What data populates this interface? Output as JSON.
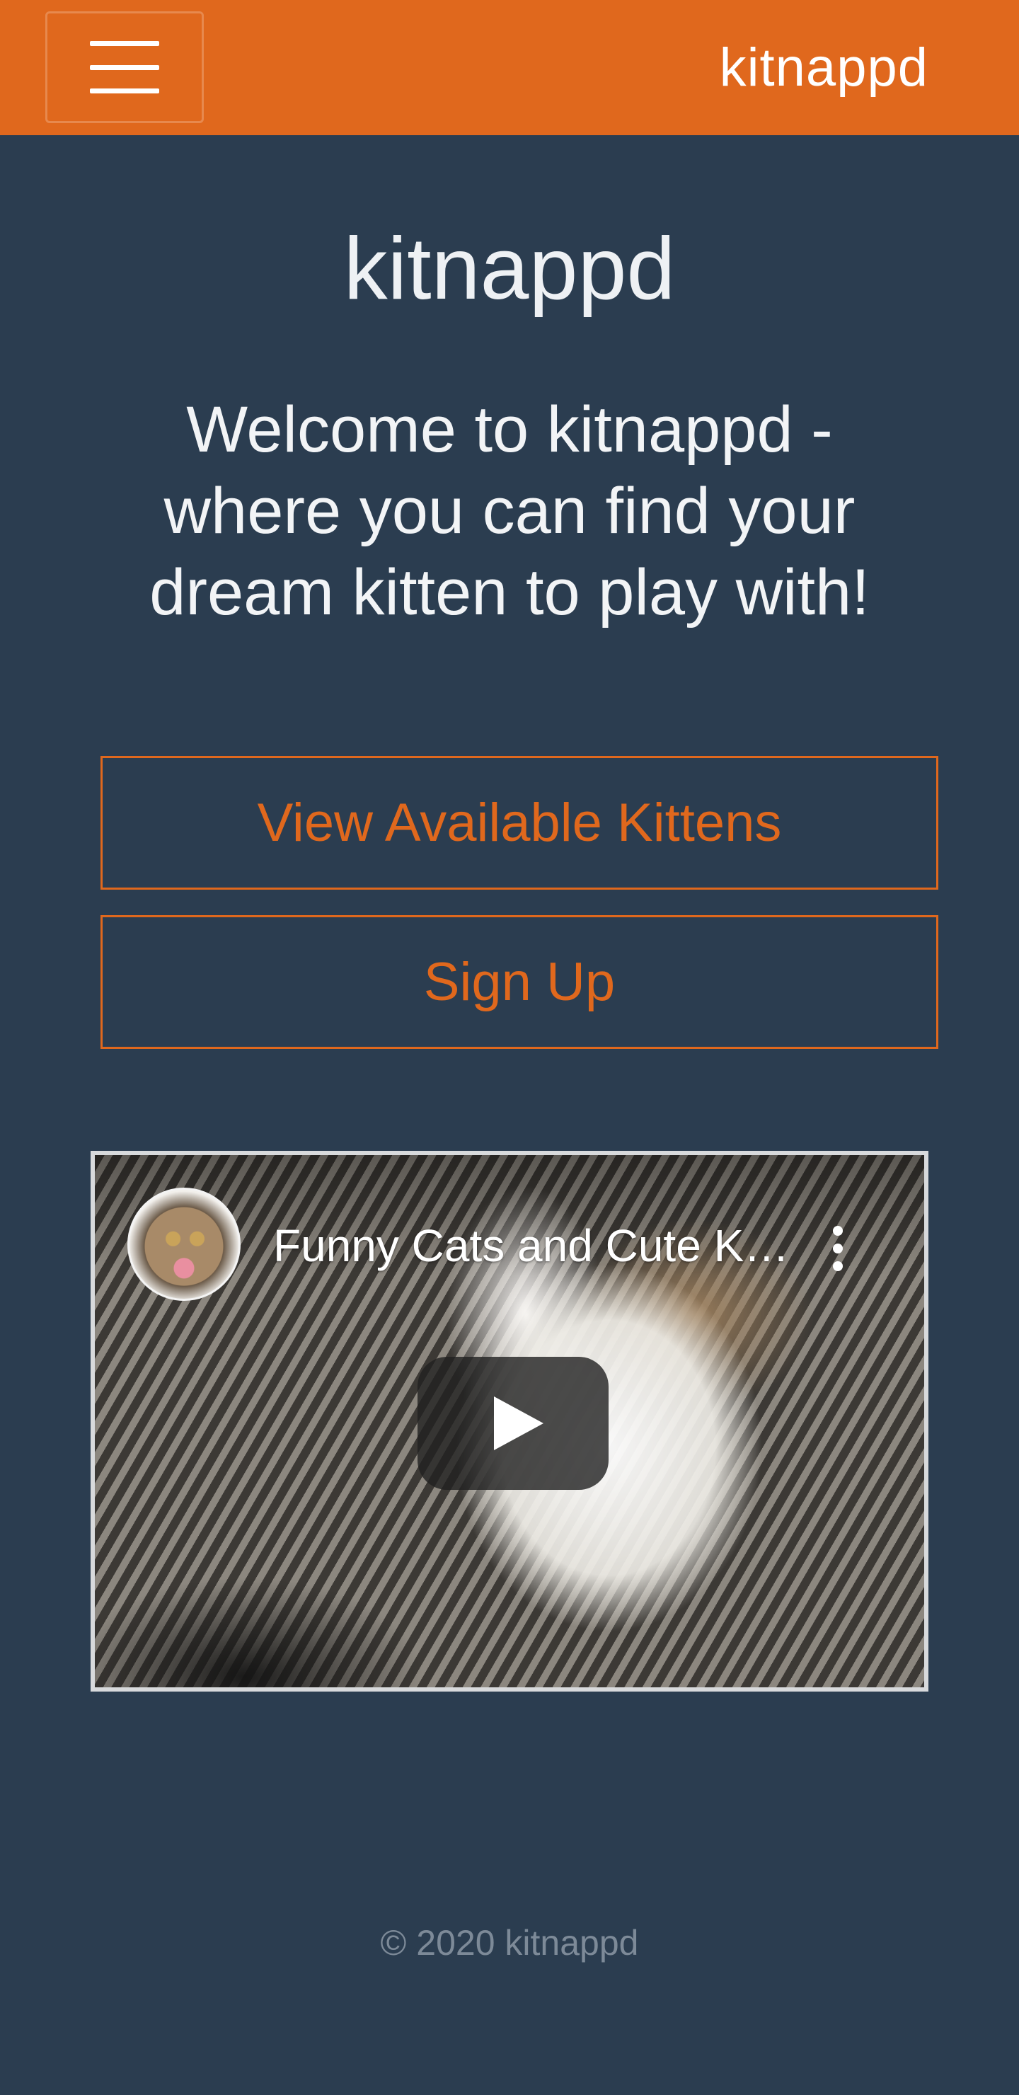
{
  "header": {
    "brand": "kitnappd",
    "menu_icon": "hamburger-menu-icon"
  },
  "main": {
    "title": "kitnappd",
    "subtitle": "Welcome to kitnappd - where you can find your dream kitten to play with!",
    "buttons": {
      "kittens_label": "View Available Kittens",
      "signup_label": "Sign Up"
    }
  },
  "video": {
    "title": "Funny Cats and Cute Kittens",
    "play_icon": "play-icon",
    "more_icon": "more-vertical-icon"
  },
  "footer": {
    "copyright": "© 2020 kitnappd"
  },
  "colors": {
    "accent": "#e0681d",
    "background": "#2b3d50"
  }
}
